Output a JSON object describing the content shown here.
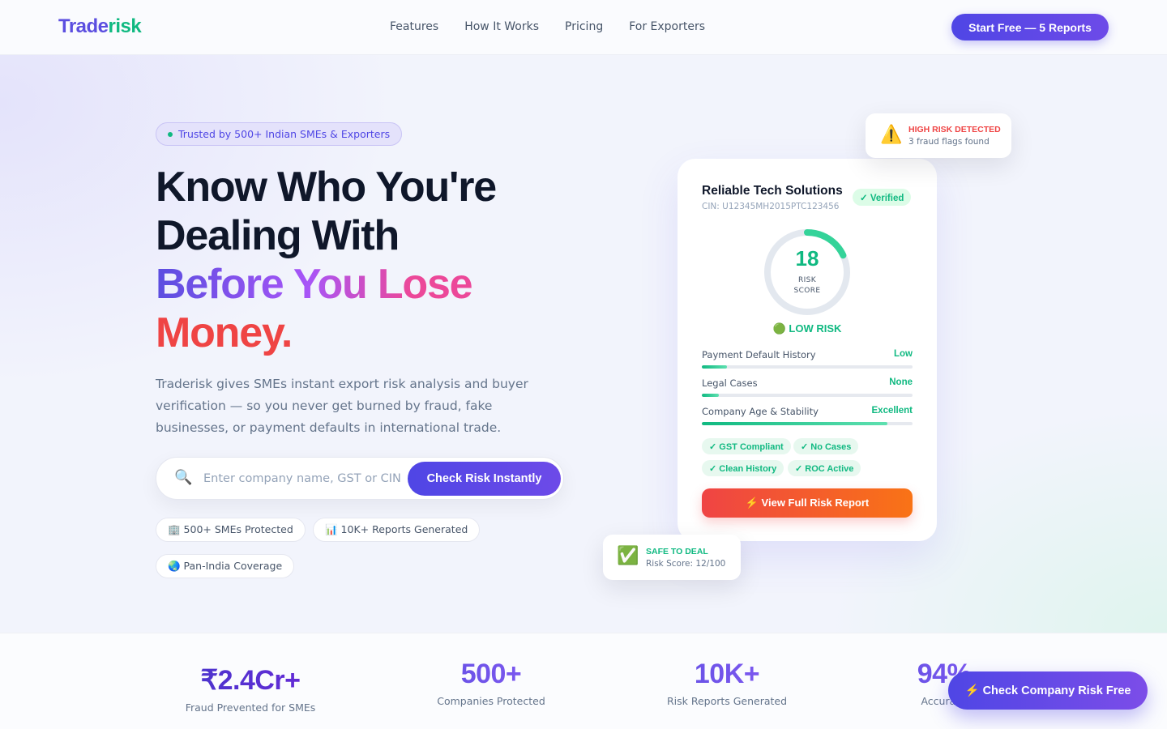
{
  "nav": {
    "logo_part1": "Trade",
    "logo_part2": "risk",
    "links": [
      "Features",
      "How It Works",
      "Pricing",
      "For Exporters"
    ],
    "cta": "Start Free — 5 Reports"
  },
  "hero": {
    "badge": "Trusted by 500+ Indian SMEs & Exporters",
    "headline_line1": "Know Who You're",
    "headline_line2": "Dealing With",
    "headline_line3": "Before You Lose",
    "headline_line4": "Money.",
    "subtitle": "Traderisk gives SMEs instant export risk analysis and buyer verification — so you never get burned by fraud, fake businesses, or payment defaults in international trade.",
    "search": {
      "icon": "magnifier-icon",
      "placeholder": "Enter company name, GST or CIN",
      "value": "",
      "button": "Check Risk Instantly"
    },
    "chips": [
      "🏢 500+ SMEs Protected",
      "📊 10K+ Reports Generated",
      "🌏 Pan-India Coverage"
    ]
  },
  "card": {
    "company": "Reliable Tech Solutions",
    "cin": "CIN: U12345MH2015PTC123456",
    "verified": "✓ Verified",
    "score": "18",
    "score_value": 18,
    "score_label_1": "RISK",
    "score_label_2": "SCORE",
    "risk_level": "🟢 LOW RISK",
    "metrics": [
      {
        "label": "Payment Default History",
        "value": "Low",
        "level": 0.12
      },
      {
        "label": "Legal Cases",
        "value": "None",
        "level": 0.08
      },
      {
        "label": "Company Age & Stability",
        "value": "Excellent",
        "level": 0.88
      }
    ],
    "tags": [
      "✓ GST Compliant",
      "✓ No Cases",
      "✓ Clean History",
      "✓ ROC Active"
    ],
    "report_button": "⚡ View Full Risk Report"
  },
  "alert_float": {
    "icon": "warning-icon",
    "glyph": "⚠️",
    "title": "HIGH RISK DETECTED",
    "detail": "3 fraud flags found"
  },
  "safe_float": {
    "icon": "check-box-icon",
    "glyph": "✅",
    "title": "SAFE TO DEAL",
    "detail": "Risk Score: 12/100"
  },
  "stats": [
    {
      "number": "₹2.4Cr+",
      "label": "Fraud Prevented for SMEs"
    },
    {
      "number": "500+",
      "label": "Companies Protected"
    },
    {
      "number": "10K+",
      "label": "Risk Reports Generated"
    },
    {
      "number": "94%",
      "label": "Accuracy"
    }
  ],
  "fab": "⚡ Check Company Risk Free",
  "colors": {
    "brand": "#5b4ee0",
    "accent_green": "#10b981",
    "danger": "#ef4444",
    "orange": "#f97316"
  }
}
